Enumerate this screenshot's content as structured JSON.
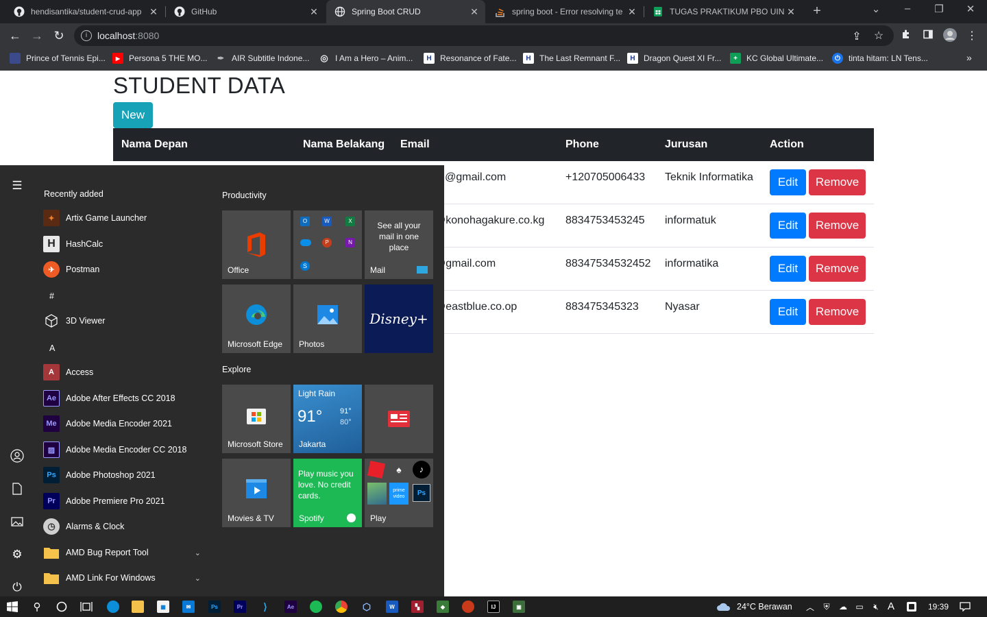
{
  "browser": {
    "tabs": [
      {
        "title": "hendisantika/student-crud-app",
        "icon": "github-icon"
      },
      {
        "title": "GitHub",
        "icon": "github-icon"
      },
      {
        "title": "Spring Boot CRUD",
        "icon": "globe-icon"
      },
      {
        "title": "spring boot - Error resolving te",
        "icon": "stackoverflow-icon"
      },
      {
        "title": "TUGAS PRAKTIKUM PBO UIN SU",
        "icon": "sheets-icon"
      }
    ],
    "new_tab": "+",
    "url_host": "localhost",
    "url_port": ":8080",
    "bookmarks": [
      "Prince of Tennis Epi...",
      "Persona 5 THE MO...",
      "AIR Subtitle Indone...",
      "I Am a Hero – Anim...",
      "Resonance of Fate...",
      "The Last Remnant F...",
      "Dragon Quest XI Fr...",
      "KC Global Ultimate...",
      "tinta hitam: LN Tens..."
    ],
    "bookmarks_more": "»"
  },
  "page": {
    "title": "STUDENT DATA",
    "new_button": "New",
    "columns": [
      "Nama Depan",
      "Nama Belakang",
      "Email",
      "Phone",
      "Jurusan",
      "Action"
    ],
    "rows": [
      {
        "email": "yil@gmail.com",
        "phone": "+120705006433",
        "jurusan": "Teknik Informatika"
      },
      {
        "email": "@konohagakure.co.kg",
        "phone": "8834753453245",
        "jurusan": "informatuk"
      },
      {
        "email": "@gmail.com",
        "phone": "88347534532452",
        "jurusan": "informatika"
      },
      {
        "email": "@eastblue.co.op",
        "phone": "883475345323",
        "jurusan": "Nyasar"
      }
    ],
    "edit_label": "Edit",
    "remove_label": "Remove"
  },
  "start_menu": {
    "recently_added": "Recently added",
    "recent_apps": [
      "Artix Game Launcher",
      "HashCalc",
      "Postman"
    ],
    "letter_hash": "#",
    "hash_apps": [
      "3D Viewer"
    ],
    "letter_a": "A",
    "a_apps": [
      "Access",
      "Adobe After Effects CC 2018",
      "Adobe Media Encoder 2021",
      "Adobe Media Encoder CC 2018",
      "Adobe Photoshop 2021",
      "Adobe Premiere Pro 2021",
      "Alarms & Clock",
      "AMD Bug Report Tool",
      "AMD Link For Windows"
    ],
    "productivity": "Productivity",
    "explore": "Explore",
    "tiles": {
      "office": "Office",
      "mail_promo": "See all your mail in one place",
      "mail": "Mail",
      "edge": "Microsoft Edge",
      "photos": "Photos",
      "disney": "Disney+",
      "store": "Microsoft Store",
      "weather_cond": "Light Rain",
      "weather_temp": "91°",
      "weather_hi": "91°",
      "weather_lo": "80°",
      "weather_city": "Jakarta",
      "movies": "Movies & TV",
      "spotify_promo": "Play music you love. No credit cards.",
      "spotify": "Spotify",
      "play": "Play",
      "prime": "prime video"
    }
  },
  "taskbar": {
    "weather": "24°C  Berawan",
    "time": "19:39",
    "ime": "A"
  },
  "colors": {
    "new_button": "#17a2b8",
    "edit_button": "#007bff",
    "remove_button": "#dc3545",
    "table_header": "#212529",
    "start_menu_bg": "#2b2b2b",
    "spotify_tile": "#1db954",
    "weather_tile": "#2b7bbf"
  }
}
